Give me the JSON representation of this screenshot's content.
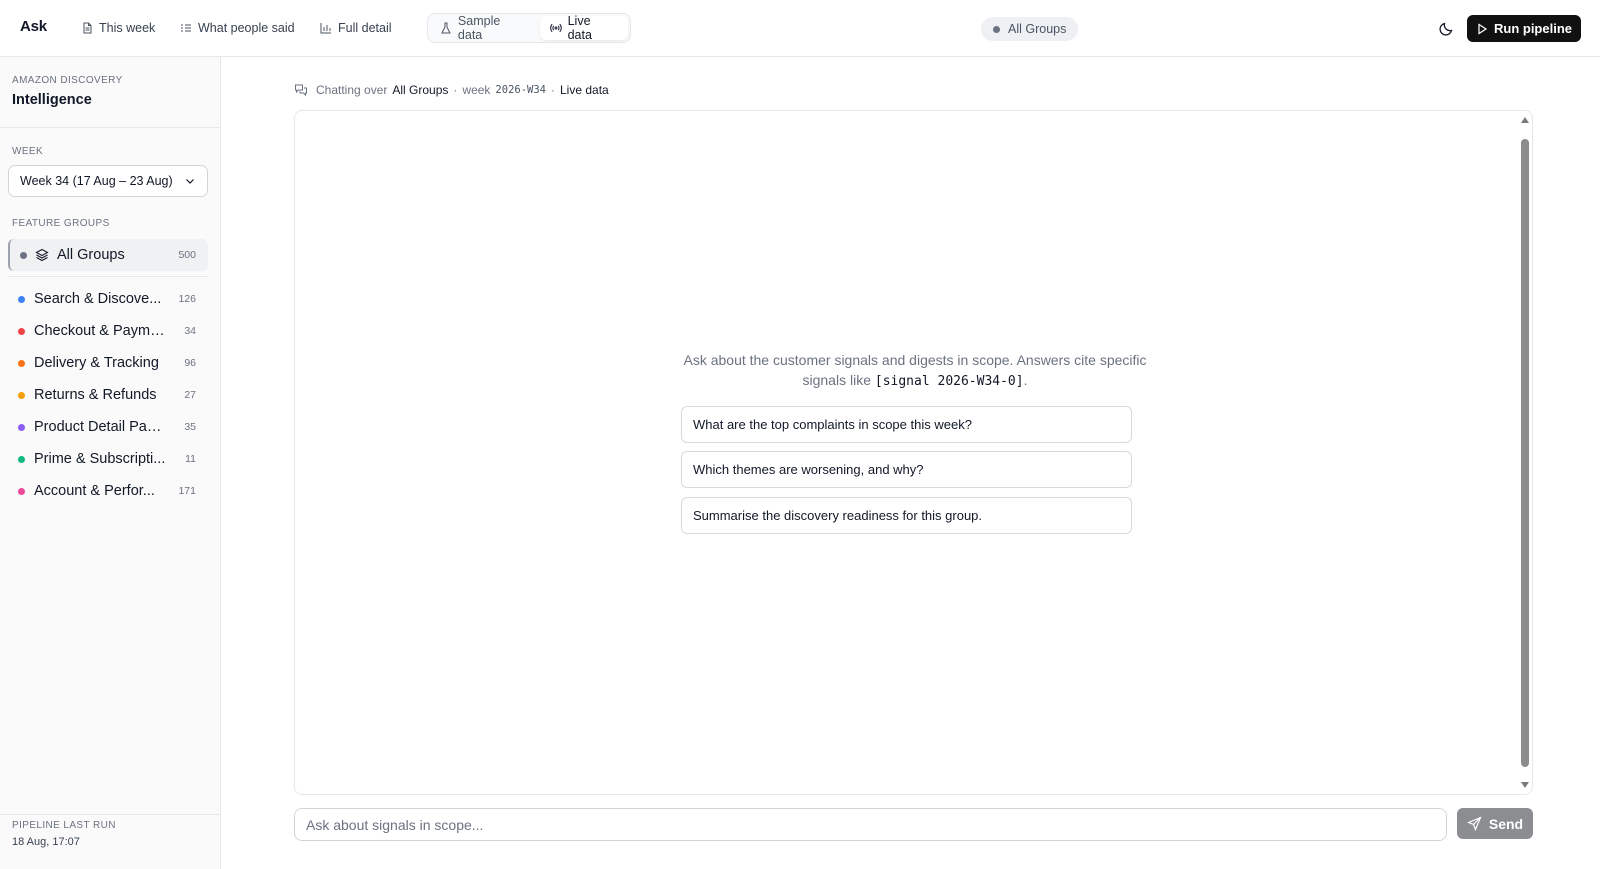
{
  "app": {
    "name": "Ask"
  },
  "nav": [
    {
      "label": "This week",
      "icon": "document-icon"
    },
    {
      "label": "What people said",
      "icon": "list-icon"
    },
    {
      "label": "Full detail",
      "icon": "bar-chart-icon"
    }
  ],
  "data_mode": {
    "options": [
      {
        "label": "Sample data",
        "icon": "flask-icon"
      },
      {
        "label": "Live data",
        "icon": "broadcast-icon"
      }
    ],
    "selected": "Live data"
  },
  "scope_pill": {
    "label": "All Groups",
    "dot_color": "#6b7280"
  },
  "header": {
    "run_label": "Run pipeline",
    "theme_icon": "moon-icon"
  },
  "sidebar": {
    "eyebrow": "AMAZON DISCOVERY",
    "title": "Intelligence",
    "week_label": "WEEK",
    "week_value": "Week 34 (17 Aug – 23 Aug)",
    "groups_label": "FEATURE GROUPS",
    "all_groups": {
      "name": "All Groups",
      "count": "500",
      "icon": "layers-icon"
    },
    "groups": [
      {
        "name": "Search & Discove...",
        "count": "126",
        "color": "#3b82f6"
      },
      {
        "name": "Checkout & Payme...",
        "count": "34",
        "color": "#ef4444"
      },
      {
        "name": "Delivery & Tracking",
        "count": "96",
        "color": "#f97316"
      },
      {
        "name": "Returns & Refunds",
        "count": "27",
        "color": "#f59e0b"
      },
      {
        "name": "Product Detail Pag...",
        "count": "35",
        "color": "#8b5cf6"
      },
      {
        "name": "Prime & Subscripti...",
        "count": "11",
        "color": "#10b981"
      },
      {
        "name": "Account & Perfor...",
        "count": "171",
        "color": "#ec4899"
      }
    ],
    "footer_label": "PIPELINE LAST RUN",
    "footer_time": "18 Aug, 17:07"
  },
  "context_bar": {
    "prefix": "Chatting over",
    "scope": "All Groups",
    "sep1": "·",
    "week_word": "week",
    "week_code": "2026-W34",
    "sep2": "·",
    "mode": "Live data"
  },
  "chat": {
    "intro_text": "Ask about the customer signals and digests in scope. Answers cite specific signals like",
    "intro_code": "[signal 2026-W34-0]",
    "intro_end": ".",
    "suggestions": [
      "What are the top complaints in scope this week?",
      "Which themes are worsening, and why?",
      "Summarise the discovery readiness for this group."
    ]
  },
  "composer": {
    "placeholder": "Ask about signals in scope...",
    "value": "",
    "send_label": "Send"
  }
}
